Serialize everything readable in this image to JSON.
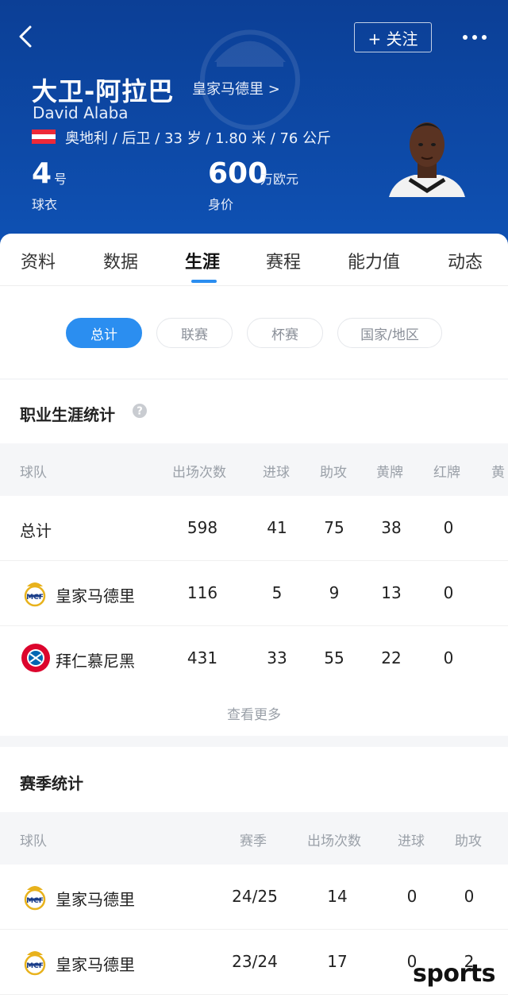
{
  "header": {
    "follow_label": "+ 关注",
    "name_cn": "大卫-阿拉巴",
    "team_link": "皇家马德里 >",
    "name_en": "David Alaba",
    "info": "奥地利 / 后卫 / 33 岁 / 1.80 米 / 76 公斤",
    "shirt_number": "4",
    "shirt_unit": "号",
    "shirt_label": "球衣",
    "value": "600",
    "value_unit": "万欧元",
    "value_label": "身价",
    "flag_colors": [
      "#ed2939",
      "#ffffff",
      "#ed2939"
    ]
  },
  "tabs": [
    "资料",
    "数据",
    "生涯",
    "赛程",
    "能力值",
    "动态"
  ],
  "active_tab": "生涯",
  "filters": [
    "总计",
    "联赛",
    "杯赛",
    "国家/地区"
  ],
  "active_filter": "总计",
  "career": {
    "title": "职业生涯统计",
    "headers": [
      "球队",
      "出场次数",
      "进球",
      "助攻",
      "黄牌",
      "红牌",
      "黄"
    ],
    "rows": [
      {
        "team": "总计",
        "apps": "598",
        "goals": "41",
        "assists": "75",
        "yellow": "38",
        "red": "0"
      },
      {
        "team": "皇家马德里",
        "apps": "116",
        "goals": "5",
        "assists": "9",
        "yellow": "13",
        "red": "0"
      },
      {
        "team": "拜仁慕尼黑",
        "apps": "431",
        "goals": "33",
        "assists": "55",
        "yellow": "22",
        "red": "0"
      }
    ],
    "more_label": "查看更多"
  },
  "season": {
    "title": "赛季统计",
    "headers": [
      "球队",
      "赛季",
      "出场次数",
      "进球",
      "助攻"
    ],
    "rows": [
      {
        "team": "皇家马德里",
        "season": "24/25",
        "apps": "14",
        "goals": "0",
        "assists": "0"
      },
      {
        "team": "皇家马德里",
        "season": "23/24",
        "apps": "17",
        "goals": "0",
        "assists": "2"
      }
    ]
  },
  "watermark": "sports",
  "colors": {
    "primary": "#0d4aa8",
    "accent": "#2b8ef0"
  }
}
